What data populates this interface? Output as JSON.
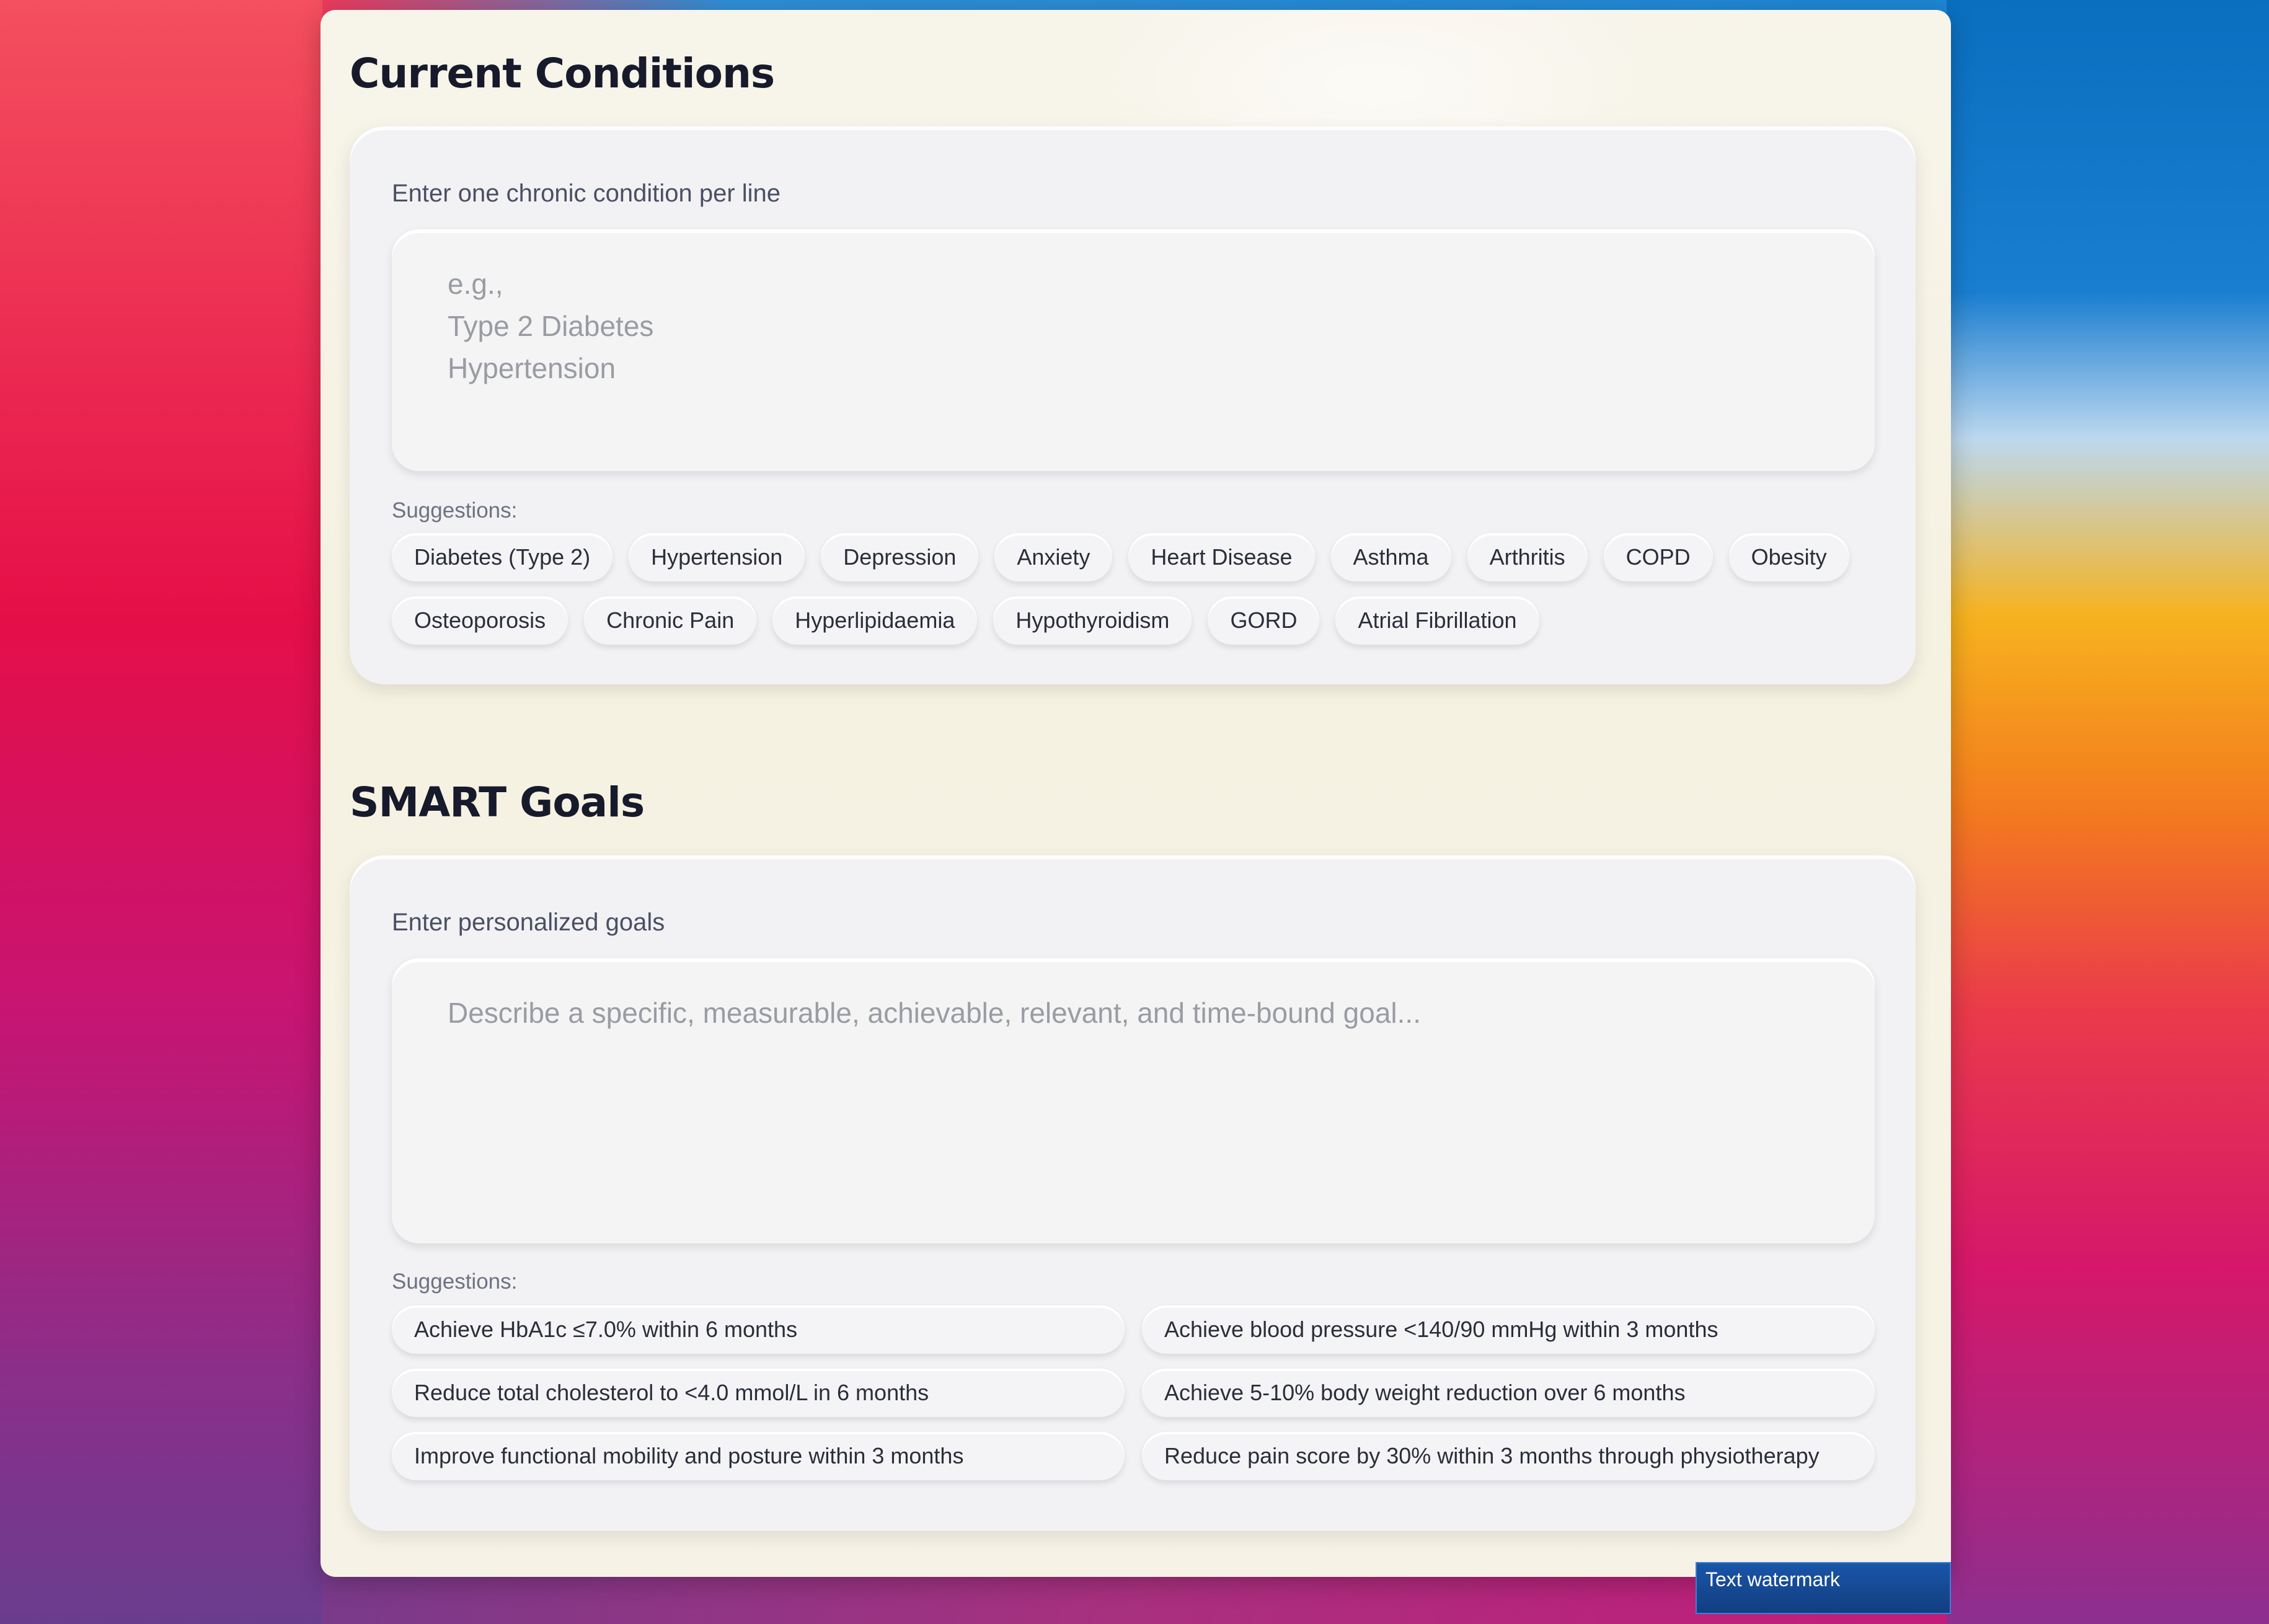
{
  "conditions": {
    "title": "Current Conditions",
    "label": "Enter one chronic condition per line",
    "placeholder": "e.g.,\nType 2 Diabetes\nHypertension",
    "suggestions_label": "Suggestions:",
    "suggestions": [
      "Diabetes (Type 2)",
      "Hypertension",
      "Depression",
      "Anxiety",
      "Heart Disease",
      "Asthma",
      "Arthritis",
      "COPD",
      "Obesity",
      "Osteoporosis",
      "Chronic Pain",
      "Hyperlipidaemia",
      "Hypothyroidism",
      "GORD",
      "Atrial Fibrillation"
    ]
  },
  "goals": {
    "title": "SMART Goals",
    "label": "Enter personalized goals",
    "placeholder": "Describe a specific, measurable, achievable, relevant, and time-bound goal...",
    "suggestions_label": "Suggestions:",
    "suggestions": [
      "Achieve HbA1c ≤7.0% within 6 months",
      "Achieve blood pressure <140/90 mmHg within 3 months",
      "Reduce total cholesterol to <4.0 mmol/L in 6 months",
      "Achieve 5-10% body weight reduction over 6 months",
      "Improve functional mobility and posture within 3 months",
      "Reduce pain score by 30% within 3 months through physiotherapy"
    ]
  },
  "watermark": "Text watermark"
}
